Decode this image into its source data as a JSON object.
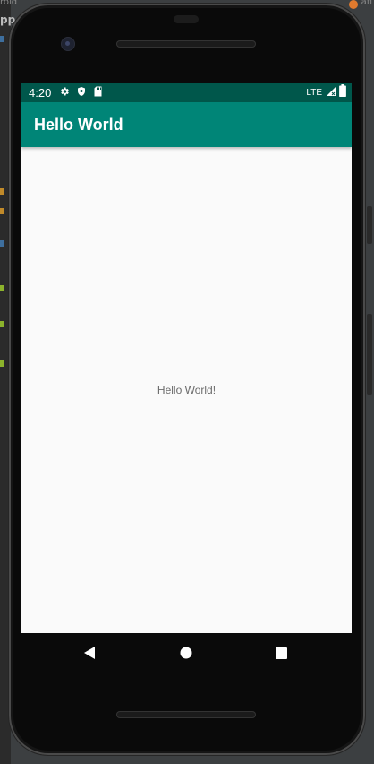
{
  "ide": {
    "top_left_fragment": "roid",
    "top_right_fragment": "afi",
    "side_label": "pp"
  },
  "status_bar": {
    "time": "4:20",
    "network": "LTE",
    "left_icons": [
      "settings-icon",
      "shield-icon",
      "sd-card-icon"
    ],
    "right_icons": [
      "signal-icon",
      "battery-icon"
    ]
  },
  "app_bar": {
    "title": "Hello World"
  },
  "content": {
    "text": "Hello World!"
  },
  "nav_bar": {
    "buttons": [
      "back-icon",
      "home-icon",
      "recents-icon"
    ]
  },
  "colors": {
    "status_bar": "#00574b",
    "app_bar": "#008577",
    "screen_background": "#fafafa",
    "content_text": "#6b6b6b"
  }
}
